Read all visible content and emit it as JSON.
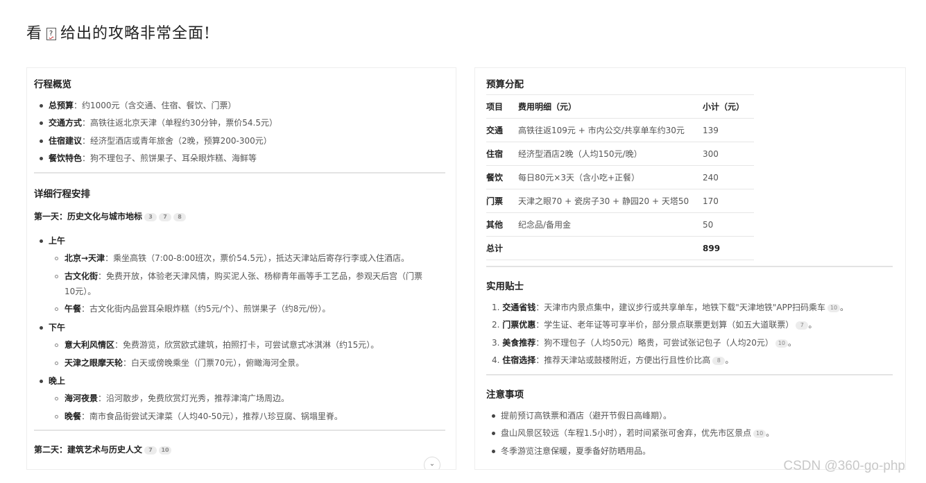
{
  "intro": {
    "text_before": "看",
    "glyph": "?",
    "text_after": "给出的攻略非常全面!"
  },
  "overview": {
    "title": "行程概览",
    "items": [
      {
        "label": "总预算",
        "text": "：约1000元（含交通、住宿、餐饮、门票）"
      },
      {
        "label": "交通方式",
        "text": "：高铁往返北京天津（单程约30分钟，票价54.5元）"
      },
      {
        "label": "住宿建议",
        "text": "：经济型酒店或青年旅舍（2晚，预算200-300元）"
      },
      {
        "label": "餐饮特色",
        "text": "：狗不理包子、煎饼果子、耳朵眼炸糕、海鲜等"
      }
    ]
  },
  "detail": {
    "title": "详细行程安排",
    "day1": {
      "title": "第一天：历史文化与城市地标",
      "badges": [
        "3",
        "7",
        "8"
      ]
    },
    "morning": "上午",
    "morning_items": [
      {
        "label": "北京→天津",
        "text": "：乘坐高铁（7:00-8:00班次，票价54.5元），抵达天津站后寄存行李或入住酒店。"
      },
      {
        "label": "古文化街",
        "text": "：免费开放，体验老天津风情，购买泥人张、杨柳青年画等手工艺品，参观天后宫（门票",
        "text2": "10元）。"
      },
      {
        "label": "午餐",
        "text": "：古文化街内品尝耳朵眼炸糕（约5元/个）、煎饼果子（约8元/份）。"
      }
    ],
    "afternoon": "下午",
    "afternoon_items": [
      {
        "label": "意大利风情区",
        "text": "：免费游览，欣赏欧式建筑，拍照打卡，可尝试意式冰淇淋（约15元）。"
      },
      {
        "label": "天津之眼摩天轮",
        "text": "：白天或傍晚乘坐（门票70元），俯瞰海河全景。"
      }
    ],
    "evening": "晚上",
    "evening_items": [
      {
        "label": "海河夜景",
        "text": "：沿河散步，免费欣赏灯光秀，推荐津湾广场周边。"
      },
      {
        "label": "晚餐",
        "text": "：南市食品街尝试天津菜（人均40-50元），推荐八珍豆腐、锅塌里脊。"
      }
    ],
    "day2": {
      "title": "第二天：建筑艺术与历史人文",
      "badges": [
        "7",
        "10"
      ]
    }
  },
  "budget": {
    "title": "预算分配",
    "headers": [
      "项目",
      "费用明细（元）",
      "小计（元）"
    ],
    "rows": [
      [
        "交通",
        "高铁往返109元 + 市内公交/共享单车约30元",
        "139"
      ],
      [
        "住宿",
        "经济型酒店2晚（人均150元/晚）",
        "300"
      ],
      [
        "餐饮",
        "每日80元×3天（含小吃+正餐）",
        "240"
      ],
      [
        "门票",
        "天津之眼70 + 瓷房子30 + 静园20 + 天塔50",
        "170"
      ],
      [
        "其他",
        "纪念品/备用金",
        "50"
      ],
      [
        "总计",
        "",
        "899"
      ]
    ]
  },
  "tips": {
    "title": "实用贴士",
    "items": [
      {
        "num": "1.",
        "label": "交通省钱",
        "text": "：天津市内景点集中，建议步行或共享单车，地铁下载\"天津地铁\"APP扫码乘车",
        "badge": "10",
        "end": "。"
      },
      {
        "num": "2.",
        "label": "门票优惠",
        "text": "：学生证、老年证等可享半价，部分景点联票更划算（如五大道联票）",
        "badge": "7",
        "end": "。"
      },
      {
        "num": "3.",
        "label": "美食推荐",
        "text": "：狗不理包子（人均50元）略贵，可尝试张记包子（人均20元）",
        "badge": "10",
        "end": "。"
      },
      {
        "num": "4.",
        "label": "住宿选择",
        "text": "：推荐天津站或鼓楼附近，方便出行且性价比高",
        "badge": "8",
        "end": "。"
      }
    ]
  },
  "notes": {
    "title": "注意事项",
    "items": [
      {
        "text": "提前预订高铁票和酒店（避开节假日高峰期）。",
        "badge": ""
      },
      {
        "text": "盘山风景区较远（车程1.5小时），若时间紧张可舍弃，优先市区景点",
        "badge": "10",
        "end": "。"
      },
      {
        "text": "冬季游览注意保暖，夏季备好防晒用品。",
        "badge": ""
      }
    ]
  },
  "ui": {
    "scroll_down_icon": "chevron-down-icon"
  },
  "watermark": "CSDN @360-go-php"
}
